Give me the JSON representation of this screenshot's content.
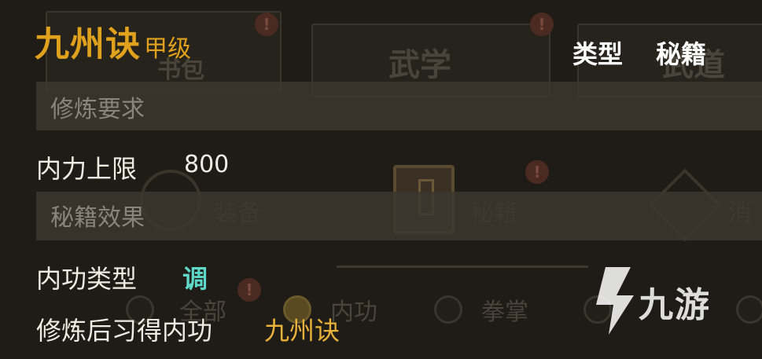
{
  "item": {
    "name": "九州诀",
    "grade": "甲级",
    "type_label": "类型",
    "type_value": "秘籍"
  },
  "sections": {
    "requirements": "修炼要求",
    "effects": "秘籍效果"
  },
  "stats": {
    "neili_label": "内力上限",
    "neili_value": "800",
    "neigong_type_label": "内功类型",
    "neigong_type_value": "调",
    "learned_label": "修炼后习得内功",
    "learned_value": "九州诀"
  },
  "background": {
    "tabs": [
      "书包",
      "武学",
      "武道"
    ],
    "categories": [
      "装备",
      "秘籍",
      "消"
    ],
    "filters": [
      "全部",
      "内功",
      "拳掌"
    ],
    "badge": "!"
  },
  "watermark": "九游",
  "colors": {
    "gold": "#e0a21c",
    "cyan": "#5ed8c8",
    "bg": "#1f1c17"
  }
}
